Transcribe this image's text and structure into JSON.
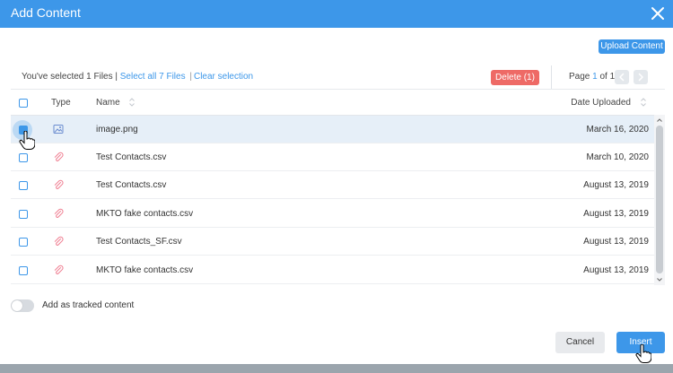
{
  "header": {
    "title": "Add Content"
  },
  "toolbar": {
    "upload_label": "Upload Content",
    "delete_label": "Delete (1)"
  },
  "selection": {
    "summary": "You've selected 1 Files |",
    "select_all": "Select all 7 Files",
    "separator": "|",
    "clear": "Clear selection"
  },
  "pager": {
    "prefix": "Page ",
    "current": "1",
    "suffix": " of 1"
  },
  "table": {
    "columns": {
      "type": "Type",
      "name": "Name",
      "date": "Date Uploaded"
    },
    "rows": [
      {
        "icon": "image-icon",
        "name": "image.png",
        "date": "March 16, 2020",
        "checked": true
      },
      {
        "icon": "paperclip-icon",
        "name": "Test Contacts.csv",
        "date": "March 10, 2020",
        "checked": false
      },
      {
        "icon": "paperclip-icon",
        "name": "Test Contacts.csv",
        "date": "August 13, 2019",
        "checked": false
      },
      {
        "icon": "paperclip-icon",
        "name": "MKTO fake contacts.csv",
        "date": "August 13, 2019",
        "checked": false
      },
      {
        "icon": "paperclip-icon",
        "name": "Test Contacts_SF.csv",
        "date": "August 13, 2019",
        "checked": false
      },
      {
        "icon": "paperclip-icon",
        "name": "MKTO fake contacts.csv",
        "date": "August 13, 2019",
        "checked": false
      }
    ]
  },
  "options": {
    "tracked_label": "Add as tracked content"
  },
  "footer": {
    "cancel_label": "Cancel",
    "insert_label": "Insert"
  },
  "colors": {
    "accent": "#3d97e9",
    "danger": "#ee6a66",
    "selected_row": "#e6eff8"
  }
}
